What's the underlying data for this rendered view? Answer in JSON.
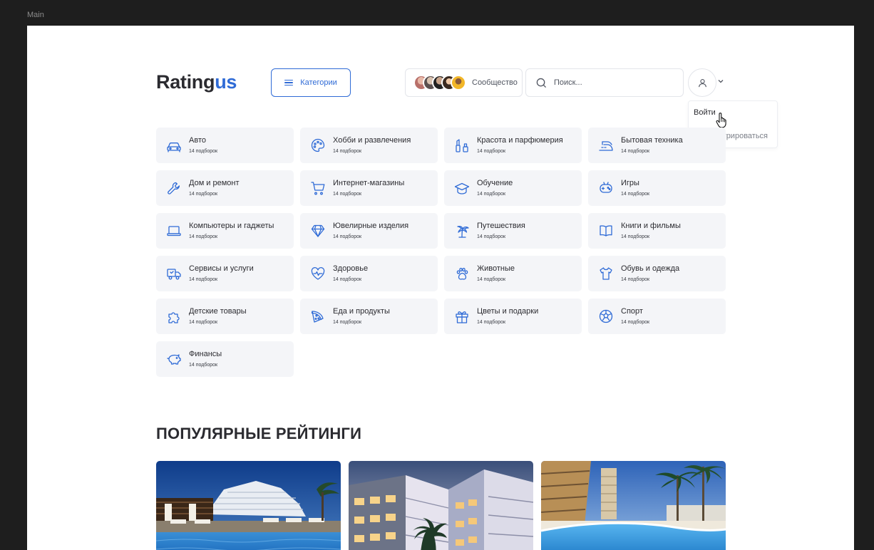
{
  "frame_label": "Main",
  "brand": {
    "logo_main": "Rating",
    "logo_accent": "us",
    "accent_color": "#2f6bd6"
  },
  "header": {
    "categories_label": "Категории",
    "community_label": "Сообщество",
    "search_placeholder": "Поиск..."
  },
  "user_menu": {
    "login": "Войти",
    "register": "Зарегистрироваться"
  },
  "categories": [
    {
      "name": "Авто",
      "count": "14 подборок",
      "icon": "car-icon"
    },
    {
      "name": "Хобби и развлечения",
      "count": "14 подборок",
      "icon": "palette-icon"
    },
    {
      "name": "Красота и парфюмерия",
      "count": "14 подборок",
      "icon": "cosmetics-icon"
    },
    {
      "name": "Бытовая техника",
      "count": "14 подборок",
      "icon": "iron-icon"
    },
    {
      "name": "Дом и ремонт",
      "count": "14 подборок",
      "icon": "wrench-icon"
    },
    {
      "name": "Интернет-магазины",
      "count": "14 подборок",
      "icon": "cart-icon"
    },
    {
      "name": "Обучение",
      "count": "14 подборок",
      "icon": "graduation-cap-icon"
    },
    {
      "name": "Игры",
      "count": "14 подборок",
      "icon": "gamepad-icon"
    },
    {
      "name": "Компьютеры и гаджеты",
      "count": "14 подборок",
      "icon": "laptop-icon"
    },
    {
      "name": "Ювелирные изделия",
      "count": "14 подборок",
      "icon": "diamond-icon"
    },
    {
      "name": "Путешествия",
      "count": "14 подборок",
      "icon": "palm-icon"
    },
    {
      "name": "Книги и фильмы",
      "count": "14 подборок",
      "icon": "book-icon"
    },
    {
      "name": "Сервисы и услуги",
      "count": "14 подборок",
      "icon": "truck-icon"
    },
    {
      "name": "Здоровье",
      "count": "14 подборок",
      "icon": "heart-pulse-icon"
    },
    {
      "name": "Животные",
      "count": "14 подборок",
      "icon": "paw-icon"
    },
    {
      "name": "Обувь и одежда",
      "count": "14 подборок",
      "icon": "shirt-icon"
    },
    {
      "name": "Детские товары",
      "count": "14 подборок",
      "icon": "puzzle-icon"
    },
    {
      "name": "Еда и продукты",
      "count": "14 подборок",
      "icon": "pizza-icon"
    },
    {
      "name": "Цветы и подарки",
      "count": "14 подборок",
      "icon": "gift-icon"
    },
    {
      "name": "Спорт",
      "count": "14 подборок",
      "icon": "ball-icon"
    },
    {
      "name": "Финансы",
      "count": "14 подборок",
      "icon": "piggy-bank-icon"
    }
  ],
  "popular": {
    "title": "ПОПУЛЯРНЫЕ РЕЙТИНГИ",
    "images": [
      "hotel-pool-image",
      "apartment-building-image",
      "resort-pool-image"
    ]
  }
}
